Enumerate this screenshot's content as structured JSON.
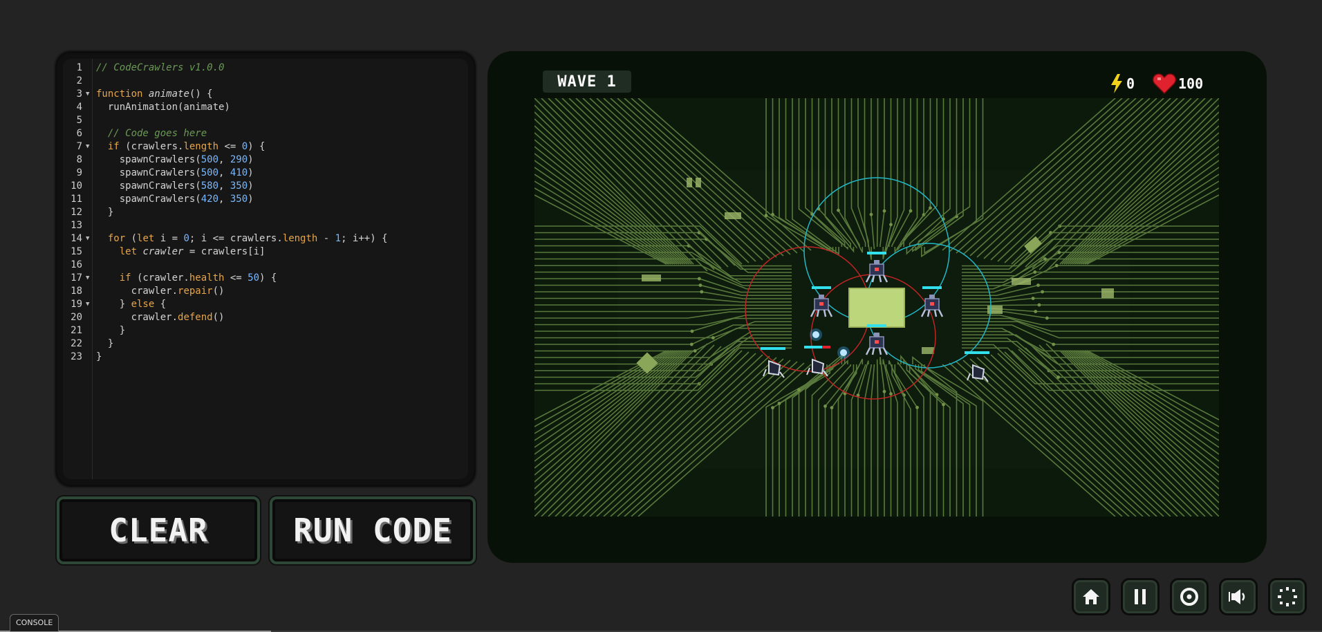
{
  "editor": {
    "lines": [
      {
        "n": "1",
        "fold": false,
        "tokens": [
          {
            "t": "// CodeCrawlers v1.0.0",
            "c": "com"
          }
        ]
      },
      {
        "n": "2",
        "fold": false,
        "tokens": []
      },
      {
        "n": "3",
        "fold": true,
        "tokens": [
          {
            "t": "function",
            "c": "kw"
          },
          {
            "t": " "
          },
          {
            "t": "animate",
            "c": "fn"
          },
          {
            "t": "() {"
          }
        ]
      },
      {
        "n": "4",
        "fold": false,
        "tokens": [
          {
            "t": "  runAnimation(animate)"
          }
        ]
      },
      {
        "n": "5",
        "fold": false,
        "tokens": []
      },
      {
        "n": "6",
        "fold": false,
        "tokens": [
          {
            "t": "  "
          },
          {
            "t": "// Code goes here",
            "c": "com"
          }
        ]
      },
      {
        "n": "7",
        "fold": true,
        "tokens": [
          {
            "t": "  "
          },
          {
            "t": "if",
            "c": "kw"
          },
          {
            "t": " (crawlers."
          },
          {
            "t": "length",
            "c": "prop"
          },
          {
            "t": " <= "
          },
          {
            "t": "0",
            "c": "num"
          },
          {
            "t": ") {"
          }
        ]
      },
      {
        "n": "8",
        "fold": false,
        "tokens": [
          {
            "t": "    spawnCrawlers("
          },
          {
            "t": "500",
            "c": "num"
          },
          {
            "t": ", "
          },
          {
            "t": "290",
            "c": "num"
          },
          {
            "t": ")"
          }
        ]
      },
      {
        "n": "9",
        "fold": false,
        "tokens": [
          {
            "t": "    spawnCrawlers("
          },
          {
            "t": "500",
            "c": "num"
          },
          {
            "t": ", "
          },
          {
            "t": "410",
            "c": "num"
          },
          {
            "t": ")"
          }
        ]
      },
      {
        "n": "10",
        "fold": false,
        "tokens": [
          {
            "t": "    spawnCrawlers("
          },
          {
            "t": "580",
            "c": "num"
          },
          {
            "t": ", "
          },
          {
            "t": "350",
            "c": "num"
          },
          {
            "t": ")"
          }
        ]
      },
      {
        "n": "11",
        "fold": false,
        "tokens": [
          {
            "t": "    spawnCrawlers("
          },
          {
            "t": "420",
            "c": "num"
          },
          {
            "t": ", "
          },
          {
            "t": "350",
            "c": "num"
          },
          {
            "t": ")"
          }
        ]
      },
      {
        "n": "12",
        "fold": false,
        "tokens": [
          {
            "t": "  }"
          }
        ]
      },
      {
        "n": "13",
        "fold": false,
        "tokens": []
      },
      {
        "n": "14",
        "fold": true,
        "tokens": [
          {
            "t": "  "
          },
          {
            "t": "for",
            "c": "kw"
          },
          {
            "t": " ("
          },
          {
            "t": "let",
            "c": "kw"
          },
          {
            "t": " i = "
          },
          {
            "t": "0",
            "c": "num"
          },
          {
            "t": "; i <= crawlers."
          },
          {
            "t": "length",
            "c": "prop"
          },
          {
            "t": " - "
          },
          {
            "t": "1",
            "c": "num"
          },
          {
            "t": "; i++) {"
          }
        ]
      },
      {
        "n": "15",
        "fold": false,
        "tokens": [
          {
            "t": "    "
          },
          {
            "t": "let",
            "c": "kw"
          },
          {
            "t": " "
          },
          {
            "t": "crawler",
            "c": "it"
          },
          {
            "t": " = crawlers[i]"
          }
        ]
      },
      {
        "n": "16",
        "fold": false,
        "tokens": []
      },
      {
        "n": "17",
        "fold": true,
        "tokens": [
          {
            "t": "    "
          },
          {
            "t": "if",
            "c": "kw"
          },
          {
            "t": " (crawler."
          },
          {
            "t": "health",
            "c": "prop"
          },
          {
            "t": " <= "
          },
          {
            "t": "50",
            "c": "num"
          },
          {
            "t": ") {"
          }
        ]
      },
      {
        "n": "18",
        "fold": false,
        "tokens": [
          {
            "t": "      crawler."
          },
          {
            "t": "repair",
            "c": "prop"
          },
          {
            "t": "()"
          }
        ]
      },
      {
        "n": "19",
        "fold": true,
        "tokens": [
          {
            "t": "    } "
          },
          {
            "t": "else",
            "c": "kw"
          },
          {
            "t": " {"
          }
        ]
      },
      {
        "n": "20",
        "fold": false,
        "tokens": [
          {
            "t": "      crawler."
          },
          {
            "t": "defend",
            "c": "prop"
          },
          {
            "t": "()"
          }
        ]
      },
      {
        "n": "21",
        "fold": false,
        "tokens": [
          {
            "t": "    }"
          }
        ]
      },
      {
        "n": "22",
        "fold": false,
        "tokens": [
          {
            "t": "  }"
          }
        ]
      },
      {
        "n": "23",
        "fold": false,
        "tokens": [
          {
            "t": "}"
          }
        ]
      }
    ]
  },
  "buttons": {
    "clear_label": "CLEAR",
    "run_label": "RUN CODE"
  },
  "game": {
    "wave_label": "WAVE 1",
    "energy_value": "0",
    "health_value": "100",
    "colors": {
      "trace": "#5f7f3f",
      "core": "#bcd67c",
      "range_cyan": "#22b8c8",
      "range_red": "#c02424",
      "health_bar": "#31e0ec",
      "plasma": "#3aa8ff"
    }
  },
  "controls": [
    {
      "name": "home-button",
      "icon": "home-icon"
    },
    {
      "name": "pause-button",
      "icon": "pause-icon"
    },
    {
      "name": "target-button",
      "icon": "target-icon"
    },
    {
      "name": "sound-button",
      "icon": "speaker-icon"
    },
    {
      "name": "settings-button",
      "icon": "loading-icon"
    }
  ],
  "console": {
    "tab_label": "CONSOLE"
  }
}
